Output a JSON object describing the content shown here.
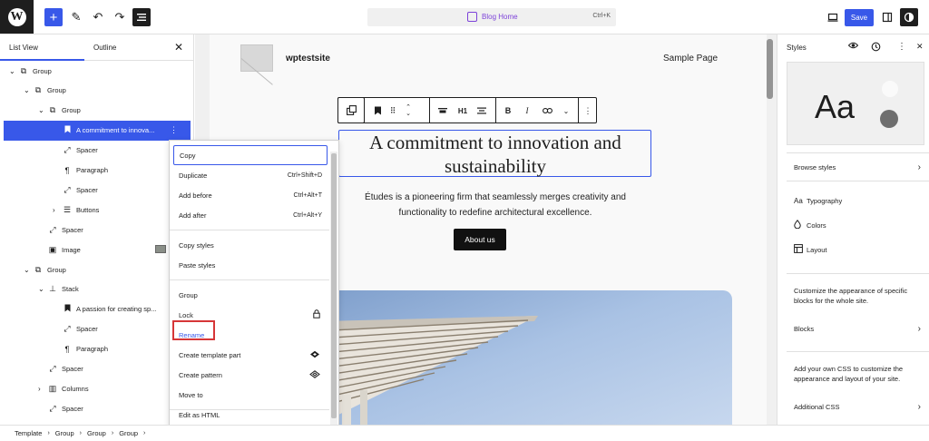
{
  "topbar": {
    "add_icon": "plus-icon",
    "command_title": "Blog Home",
    "command_shortcut": "Ctrl+K",
    "save_label": "Save",
    "accent": "#3858e9",
    "command_color": "#7d42d9"
  },
  "listview": {
    "tab_list": "List View",
    "tab_outline": "Outline",
    "rows": [
      {
        "label": "Group",
        "icon": "group-icon",
        "level": 0,
        "expanded": true
      },
      {
        "label": "Group",
        "icon": "group-icon",
        "level": 1,
        "expanded": true
      },
      {
        "label": "Group",
        "icon": "group-icon",
        "level": 2,
        "expanded": true
      },
      {
        "label": "A commitment to innova...",
        "icon": "heading-icon",
        "level": 3,
        "selected": true
      },
      {
        "label": "Spacer",
        "icon": "spacer-icon",
        "level": 3
      },
      {
        "label": "Paragraph",
        "icon": "paragraph-icon",
        "level": 3
      },
      {
        "label": "Spacer",
        "icon": "spacer-icon",
        "level": 3
      },
      {
        "label": "Buttons",
        "icon": "buttons-icon",
        "level": 3,
        "collapsed": true
      },
      {
        "label": "Spacer",
        "icon": "spacer-icon",
        "level": 2
      },
      {
        "label": "Image",
        "icon": "image-icon",
        "level": 2
      },
      {
        "label": "Group",
        "icon": "group-icon",
        "level": 1,
        "expanded": true
      },
      {
        "label": "Stack",
        "icon": "stack-icon",
        "level": 2,
        "expanded": true
      },
      {
        "label": "A passion for creating sp...",
        "icon": "heading-icon",
        "level": 3
      },
      {
        "label": "Spacer",
        "icon": "spacer-icon",
        "level": 3
      },
      {
        "label": "Paragraph",
        "icon": "paragraph-icon",
        "level": 3
      },
      {
        "label": "Spacer",
        "icon": "spacer-icon",
        "level": 2
      },
      {
        "label": "Columns",
        "icon": "columns-icon",
        "level": 2,
        "collapsed": true
      },
      {
        "label": "Spacer",
        "icon": "spacer-icon",
        "level": 2
      },
      {
        "label": "Columns",
        "icon": "columns-icon",
        "level": 2,
        "collapsed": true
      }
    ]
  },
  "breadcrumb": [
    "Template",
    "Group",
    "Group",
    "Group"
  ],
  "canvas": {
    "site_title": "wptestsite",
    "nav_link": "Sample Page",
    "toolbar_heading_level": "H1",
    "heading": "A commitment to innovation and sustainability",
    "subtitle": "Études is a pioneering firm that seamlessly merges creativity and functionality to redefine architectural excellence.",
    "button_label": "About us"
  },
  "context_menu": {
    "items": [
      {
        "label": "Copy",
        "shortcut": ""
      },
      {
        "label": "Duplicate",
        "shortcut": "Ctrl+Shift+D"
      },
      {
        "label": "Add before",
        "shortcut": "Ctrl+Alt+T"
      },
      {
        "label": "Add after",
        "shortcut": "Ctrl+Alt+Y"
      },
      {
        "label": "Copy styles",
        "shortcut": ""
      },
      {
        "label": "Paste styles",
        "shortcut": ""
      },
      {
        "label": "Group",
        "shortcut": ""
      },
      {
        "label": "Lock",
        "shortcut": ""
      },
      {
        "label": "Rename",
        "shortcut": ""
      },
      {
        "label": "Create template part",
        "shortcut": ""
      },
      {
        "label": "Create pattern",
        "shortcut": ""
      },
      {
        "label": "Move to",
        "shortcut": ""
      },
      {
        "label": "Edit as HTML",
        "shortcut": ""
      }
    ],
    "highlight_color": "#d63638"
  },
  "styles_panel": {
    "title": "Styles",
    "preview_text": "Aa",
    "browse": "Browse styles",
    "typography": "Typography",
    "colors": "Colors",
    "layout": "Layout",
    "customize_text": "Customize the appearance of specific blocks for the whole site.",
    "blocks": "Blocks",
    "css_text": "Add your own CSS to customize the appearance and layout of your site.",
    "additional_css": "Additional CSS"
  }
}
